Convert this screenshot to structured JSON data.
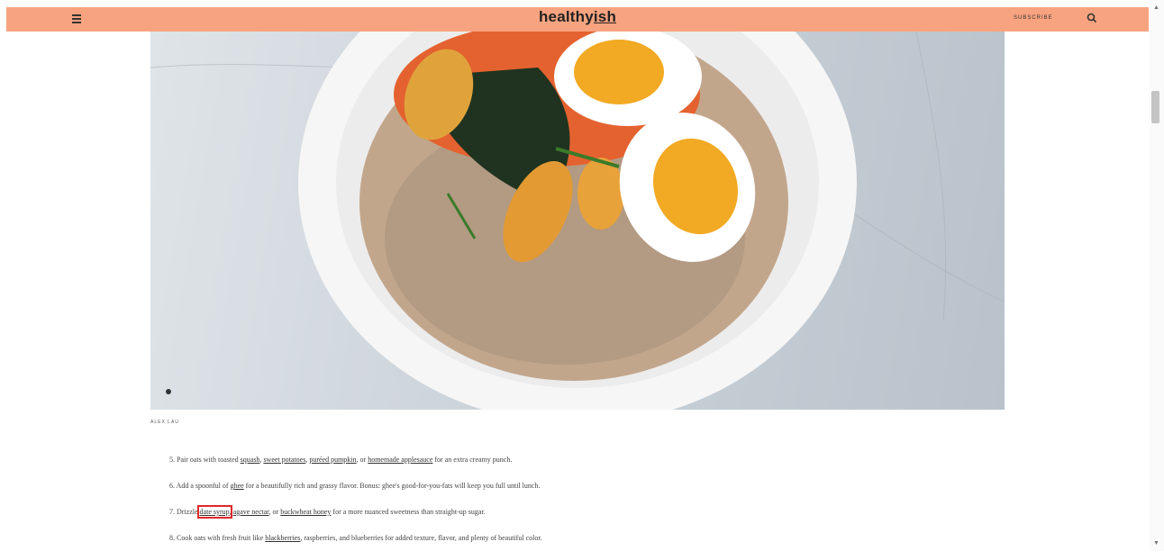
{
  "header": {
    "logo_main": "healthy",
    "logo_suffix": "ish",
    "subscribe_label": "SUBSCRIBE"
  },
  "caption": "ALEX LAU",
  "list": [
    {
      "num": "5.",
      "parts": [
        {
          "t": "Pair oats with toasted "
        },
        {
          "t": "squash",
          "link": true
        },
        {
          "t": ", "
        },
        {
          "t": "sweet potatoes",
          "link": true
        },
        {
          "t": ", "
        },
        {
          "t": "puréed pumpkin",
          "link": true
        },
        {
          "t": ", or "
        },
        {
          "t": "homemade applesauce",
          "link": true
        },
        {
          "t": " for an extra creamy punch."
        }
      ]
    },
    {
      "num": "6.",
      "parts": [
        {
          "t": "Add a spoonful of "
        },
        {
          "t": "ghee",
          "link": true
        },
        {
          "t": " for a beautifully rich and grassy flavor. Bonus: ghee's good-for-you-fats will keep you full until lunch."
        }
      ]
    },
    {
      "num": "7.",
      "parts": [
        {
          "t": "Drizzle "
        },
        {
          "t": "date syrup",
          "link": true,
          "highlight": true
        },
        {
          "t": ", "
        },
        {
          "t": "agave nectar",
          "link": true
        },
        {
          "t": ", or "
        },
        {
          "t": "buckwheat honey",
          "link": true
        },
        {
          "t": " for a more nuanced sweetness than straight-up sugar."
        }
      ]
    },
    {
      "num": "8.",
      "parts": [
        {
          "t": "Cook oats with fresh fruit like "
        },
        {
          "t": "blackberries",
          "link": true
        },
        {
          "t": ", raspberries, and blueberries for added texture, flavor, and plenty of beautiful color."
        }
      ]
    }
  ],
  "colors": {
    "header_bg": "#f8a37f",
    "highlight": "#e0282a"
  },
  "icons": [
    "hamburger-menu-icon",
    "search-icon",
    "scroll-up-icon",
    "scroll-down-icon"
  ]
}
